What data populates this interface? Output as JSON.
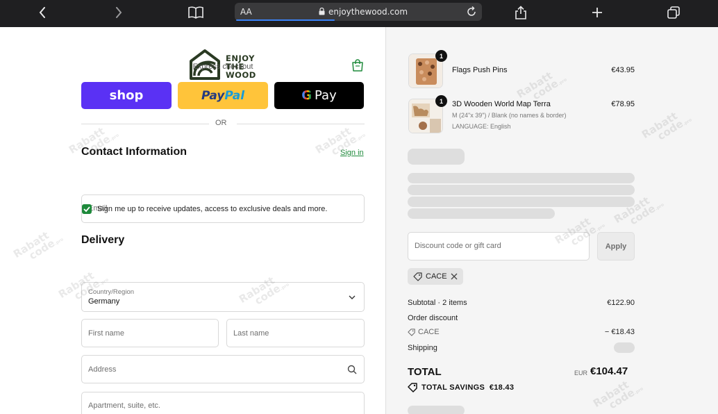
{
  "browser": {
    "text_size_label": "AA",
    "url": "enjoythewood.com"
  },
  "brand": {
    "logo_line1": "ENJOY",
    "logo_line2": "THE",
    "logo_line3": "WOOD",
    "accent": "#1e8a3b"
  },
  "checkout": {
    "express_label": "Express checkout",
    "shop_label": "shop",
    "paypal_part1": "Pay",
    "paypal_part2": "Pal",
    "gpay_g": "G",
    "gpay_label": "Pay",
    "or_label": "OR",
    "contact_title": "Contact Information",
    "sign_in": "Sign in",
    "email_placeholder": "Email",
    "newsletter_label": "Sign me up to receive updates, access to exclusive deals and more.",
    "newsletter_checked": true,
    "delivery_title": "Delivery",
    "country_label": "Country/Region",
    "country_value": "Germany",
    "first_name_placeholder": "First name",
    "last_name_placeholder": "Last name",
    "address_placeholder": "Address",
    "apartment_placeholder": "Apartment, suite, etc."
  },
  "summary": {
    "items": [
      {
        "qty": "1",
        "name": "Flags Push Pins",
        "price": "€43.95",
        "variant": "",
        "language": ""
      },
      {
        "qty": "1",
        "name": "3D Wooden World Map Terra",
        "price": "€78.95",
        "variant": "M (24\"x 39\") / Blank (no names & border)",
        "language": "LANGUAGE: English"
      }
    ],
    "discount_placeholder": "Discount code or gift card",
    "apply_label": "Apply",
    "applied_code": "CACE",
    "subtotal_label": "Subtotal · 2 items",
    "subtotal_value": "€122.90",
    "order_discount_label": "Order discount",
    "discount_code": "CACE",
    "discount_value": "− €18.43",
    "shipping_label": "Shipping",
    "total_label": "TOTAL",
    "currency": "EUR",
    "total_value": "€104.47",
    "savings_label": "TOTAL SAVINGS",
    "savings_value": "€18.43"
  },
  "watermark": {
    "line1": "Rabatt",
    "line2": "code",
    "suffix": ".pro"
  }
}
